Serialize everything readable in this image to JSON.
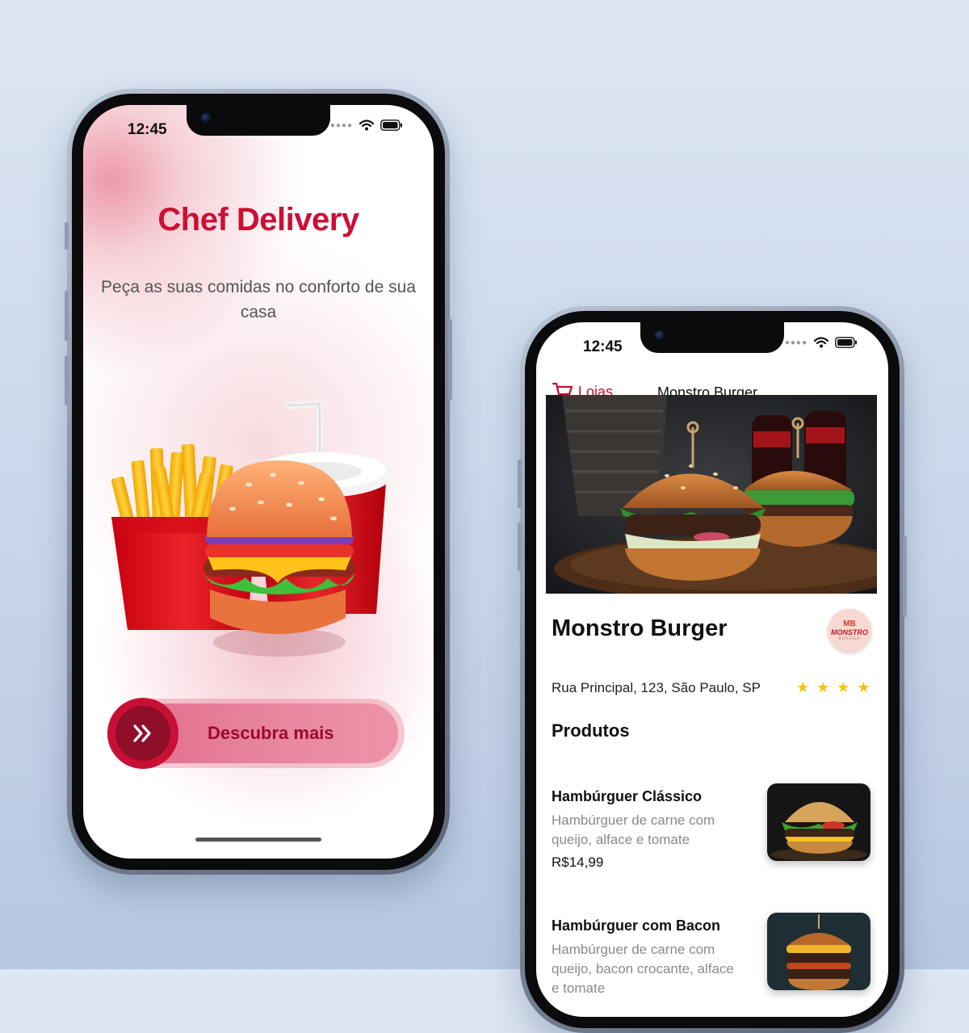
{
  "welcome": {
    "status_time": "12:45",
    "title": "Chef Delivery",
    "subtitle": "Peça as suas comidas no conforto de sua casa",
    "cta_label": "Descubra mais"
  },
  "store_screen": {
    "status_time": "12:45",
    "back_label": "Lojas",
    "nav_title": "Monstro Burger",
    "store_name": "Monstro Burger",
    "logo_text": {
      "top": "MB",
      "main": "MONSTRO",
      "sub": "BURGER"
    },
    "address": "Rua Principal, 123, São Paulo, SP",
    "rating": 4,
    "section_title": "Produtos",
    "products": [
      {
        "name": "Hambúrguer Clássico",
        "description": "Hambúrguer de carne com queijo, alface e tomate",
        "price": "R$14,99"
      },
      {
        "name": "Hambúrguer com Bacon",
        "description": "Hambúrguer de carne com queijo, bacon crocante, alface e tomate",
        "price": ""
      }
    ]
  },
  "icons": [
    "wifi-icon",
    "battery-icon",
    "double-chevron-right-icon",
    "cart-icon",
    "star-icon"
  ],
  "colors": {
    "brand_red": "#cc0f35",
    "knob_dark": "#8f0e2a",
    "star": "#f4c20d"
  }
}
